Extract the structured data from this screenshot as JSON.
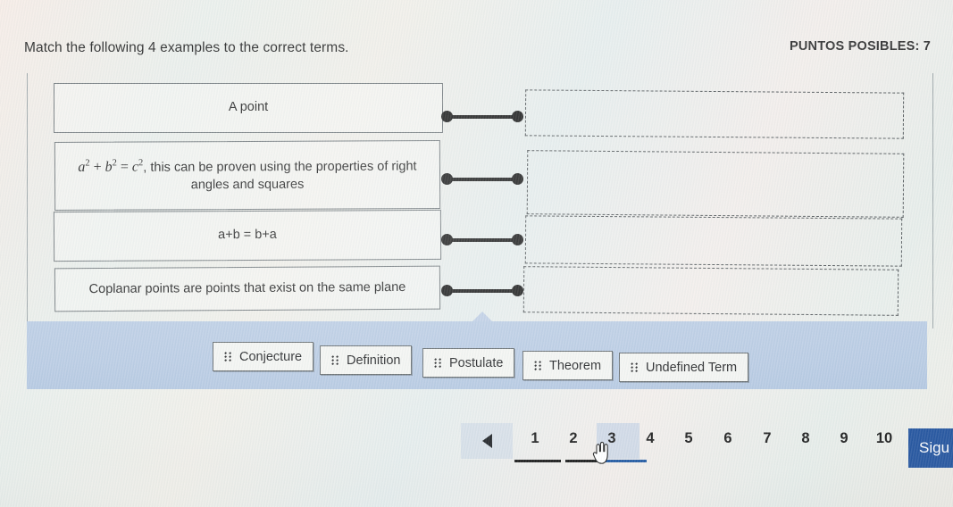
{
  "header": {
    "prompt": "Match the following 4 examples to the correct terms.",
    "points_label": "PUNTOS POSIBLES: 7"
  },
  "matching": {
    "prompts": [
      {
        "text": "A point",
        "is_math": false
      },
      {
        "text": "a² + b² = c², this can be proven using the properties of right angles and squares",
        "is_math": true
      },
      {
        "text": "a+b = b+a",
        "is_math": false
      },
      {
        "text": "Coplanar points are points that exist on the same plane",
        "is_math": false
      }
    ],
    "drop_zones": [
      {
        "value": "",
        "placeholder": ""
      },
      {
        "value": "",
        "placeholder": ""
      },
      {
        "value": "",
        "placeholder": ""
      },
      {
        "value": "",
        "placeholder": ""
      }
    ]
  },
  "answer_bank": {
    "chips": [
      {
        "label": "Conjecture",
        "handle": "drag-handle-icon"
      },
      {
        "label": "Definition",
        "handle": "drag-handle-icon"
      },
      {
        "label": "Postulate",
        "handle": "drag-handle-icon"
      },
      {
        "label": "Theorem",
        "handle": "drag-handle-icon"
      },
      {
        "label": "Undefined Term",
        "handle": "drag-handle-icon"
      }
    ]
  },
  "pagination": {
    "prev_icon": "triangle-left-icon",
    "pages": [
      {
        "label": "1",
        "state": "visited"
      },
      {
        "label": "2",
        "state": "visited"
      },
      {
        "label": "3",
        "state": "current"
      },
      {
        "label": "4",
        "state": "unvisited"
      },
      {
        "label": "5",
        "state": "unvisited"
      },
      {
        "label": "6",
        "state": "unvisited"
      },
      {
        "label": "7",
        "state": "unvisited"
      },
      {
        "label": "8",
        "state": "unvisited"
      },
      {
        "label": "9",
        "state": "unvisited"
      },
      {
        "label": "10",
        "state": "unvisited"
      }
    ],
    "next_button_label": "Sigu",
    "current_page": "3"
  },
  "colors": {
    "accent_blue": "#1d4f9c",
    "active_underline": "#19539e",
    "answer_bank_bg": "#b6c9e2",
    "page_bg": "#e9ebe6",
    "box_border": "#6d7478",
    "connector": "#141414"
  },
  "cursor": {
    "type": "pointing-hand-cursor"
  }
}
